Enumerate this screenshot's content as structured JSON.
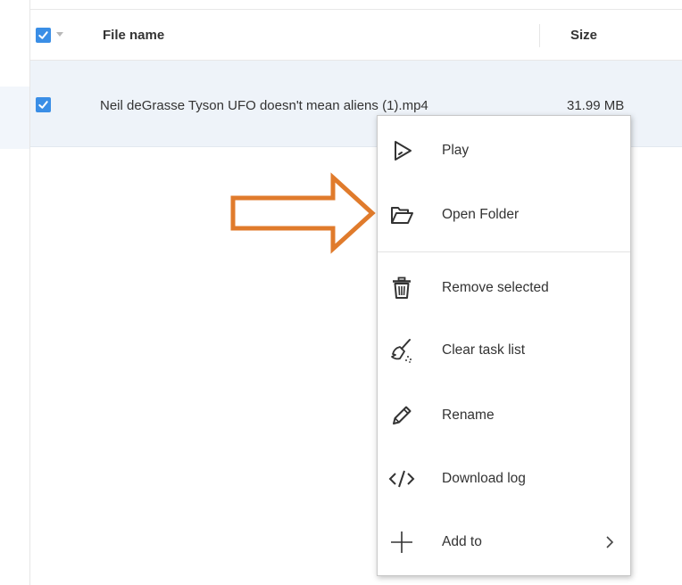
{
  "header": {
    "select_all_checked": true,
    "columns": [
      {
        "key": "name",
        "label": "File name"
      },
      {
        "key": "size",
        "label": "Size"
      }
    ]
  },
  "files": [
    {
      "checked": true,
      "name": "Neil deGrasse Tyson UFO doesn't mean aliens (1).mp4",
      "size": "31.99 MB"
    }
  ],
  "context_menu": {
    "items": [
      {
        "label": "Play",
        "icon": "play-icon"
      },
      {
        "label": "Open Folder",
        "icon": "folder-open-icon"
      },
      {
        "label": "Remove selected",
        "icon": "trash-icon"
      },
      {
        "label": "Clear task list",
        "icon": "broom-icon"
      },
      {
        "label": "Rename",
        "icon": "pencil-icon"
      },
      {
        "label": "Download log",
        "icon": "code-icon"
      },
      {
        "label": "Add to",
        "icon": "plus-icon",
        "has_submenu": true
      }
    ]
  },
  "annotation": {
    "arrow_color": "#e07b2c",
    "points_to": "Open Folder"
  },
  "colors": {
    "checkbox": "#3a8ee6",
    "selected_row": "#eef3f9"
  }
}
